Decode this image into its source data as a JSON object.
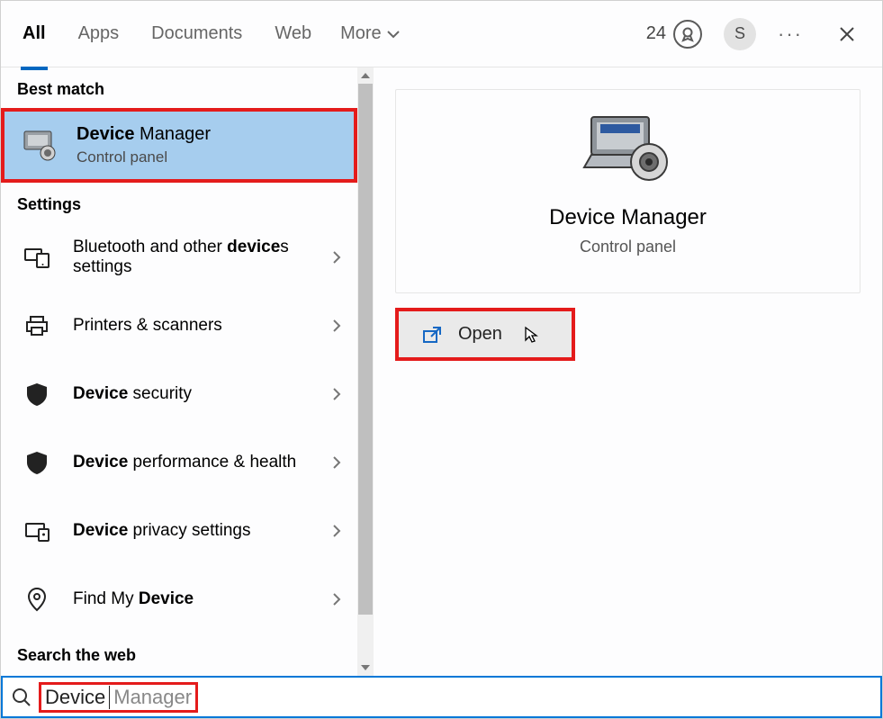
{
  "topbar": {
    "tabs": [
      "All",
      "Apps",
      "Documents",
      "Web",
      "More"
    ],
    "rewards_points": "24",
    "avatar_initial": "S"
  },
  "left": {
    "best_match_heading": "Best match",
    "best": {
      "title_bold": "Device",
      "title_rest": " Manager",
      "subtitle": "Control panel"
    },
    "settings_heading": "Settings",
    "items": [
      {
        "pre": "Bluetooth and other ",
        "bold": "device",
        "post": "s settings"
      },
      {
        "pre": "Printers & scanners",
        "bold": "",
        "post": ""
      },
      {
        "pre": "",
        "bold": "Device",
        "post": " security"
      },
      {
        "pre": "",
        "bold": "Device",
        "post": " performance & health"
      },
      {
        "pre": "",
        "bold": "Device",
        "post": " privacy settings"
      },
      {
        "pre": "Find My ",
        "bold": "Device",
        "post": ""
      }
    ],
    "search_web_heading": "Search the web"
  },
  "preview": {
    "title": "Device Manager",
    "subtitle": "Control panel",
    "open_label": "Open"
  },
  "search": {
    "typed": "Device",
    "ghost": " Manager"
  }
}
